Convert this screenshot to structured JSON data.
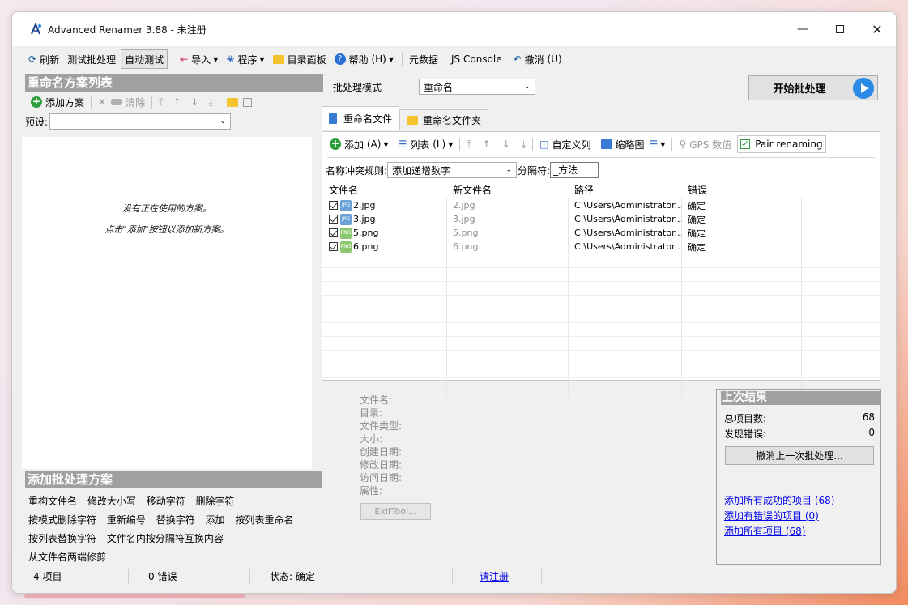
{
  "window": {
    "title": "Advanced Renamer 3.88 - 未注册"
  },
  "menu": {
    "refresh": "刷新",
    "test_batch": "测试批处理",
    "auto_test": "自动测试",
    "import": "导入",
    "program": "程序",
    "dir_panel": "目录面板",
    "help": "帮助",
    "help_key": "(H)",
    "metadata": "元数据",
    "js_console": "JS Console",
    "undo": "撤消",
    "undo_key": "(U)"
  },
  "left": {
    "scheme_list_title": "重命名方案列表",
    "add_scheme": "添加方案",
    "clear": "清除",
    "preset_label": "预设:",
    "preset_value": "",
    "empty_line1": "没有正在使用的方案。",
    "empty_line2": "点击\"添加\"按钮以添加新方案。",
    "add_method_title": "添加批处理方案",
    "methods": [
      "重构文件名",
      "修改大小写",
      "移动字符",
      "删除字符",
      "按模式删除字符",
      "重新编号",
      "替换字符",
      "添加",
      "按列表重命名",
      "按列表替换字符",
      "文件名内按分隔符互换内容",
      "从文件名两端修剪"
    ]
  },
  "batch": {
    "mode_label": "批处理模式",
    "mode_value": "重命名",
    "start_button": "开始批处理"
  },
  "tabs": {
    "rename_files": "重命名文件",
    "rename_folders": "重命名文件夹"
  },
  "files_toolbar": {
    "add": "添加",
    "add_key": "(A)",
    "list": "列表",
    "list_key": "(L)",
    "custom_columns": "自定义列",
    "thumbnails": "缩略图",
    "gps": "GPS 数值",
    "pair_renaming": "Pair renaming"
  },
  "conflict": {
    "label": "名称冲突规则:",
    "value": "添加递增数字",
    "separator_label": "分隔符:",
    "separator_value": "_方法"
  },
  "grid": {
    "headers": [
      "文件名",
      "新文件名",
      "路径",
      "错误"
    ],
    "rows": [
      {
        "name": "2.jpg",
        "new_name": "2.jpg",
        "path": "C:\\Users\\Administrator....",
        "error": "确定",
        "type": "JPG"
      },
      {
        "name": "3.jpg",
        "new_name": "3.jpg",
        "path": "C:\\Users\\Administrator....",
        "error": "确定",
        "type": "JPG"
      },
      {
        "name": "5.png",
        "new_name": "5.png",
        "path": "C:\\Users\\Administrator....",
        "error": "确定",
        "type": "PNG"
      },
      {
        "name": "6.png",
        "new_name": "6.png",
        "path": "C:\\Users\\Administrator....",
        "error": "确定",
        "type": "PNG"
      }
    ]
  },
  "properties": {
    "labels": [
      "文件名:",
      "目录:",
      "文件类型:",
      "大小:",
      "创建日期:",
      "修改日期:",
      "访问日期:",
      "属性:"
    ],
    "exif_button": "ExifTool..."
  },
  "last_result": {
    "title": "上次结果",
    "total_label": "总项目数:",
    "total_value": "68",
    "errors_label": "发现错误:",
    "errors_value": "0",
    "undo_button": "撤消上一次批处理...",
    "link_success": "添加所有成功的项目 (68)",
    "link_errors": "添加有错误的项目 (0)",
    "link_all": "添加所有项目 (68)"
  },
  "status": {
    "items": "4 项目",
    "errors": "0 错误",
    "state": "状态: 确定",
    "register": "请注册"
  },
  "colors": {
    "accent": "#2a8ae6",
    "header_gray": "#a0a0a0",
    "add_green": "#2e9e3e"
  }
}
